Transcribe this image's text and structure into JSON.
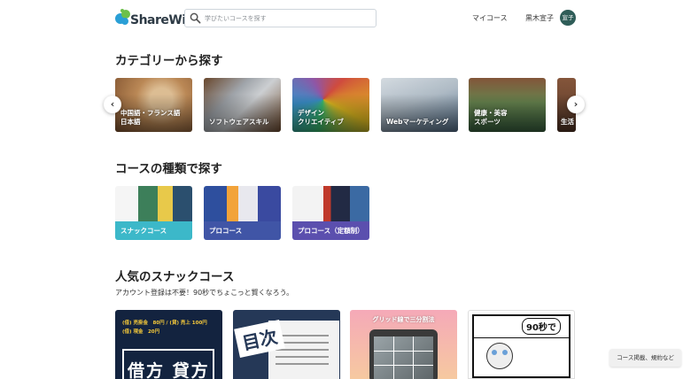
{
  "header": {
    "logo_text": "ShareWis",
    "search_placeholder": "学びたいコースを探す",
    "nav_my_courses": "マイコース",
    "nav_user_name": "黒木宣子",
    "avatar_text": "宣子"
  },
  "categories": {
    "title": "カテゴリーから探す",
    "items": [
      {
        "label": "中国語・フランス語\n日本語"
      },
      {
        "label": "ソフトウェアスキル"
      },
      {
        "label": "デザイン\nクリエイティブ"
      },
      {
        "label": "Webマーケティング"
      },
      {
        "label": "健康・美容\nスポーツ"
      },
      {
        "label": "生活"
      }
    ]
  },
  "course_types": {
    "title": "コースの種類で探す",
    "items": [
      {
        "label": "スナックコース",
        "color": "#3cb8c9"
      },
      {
        "label": "プロコース",
        "color": "#4055a6"
      },
      {
        "label": "プロコース（定額制）",
        "color": "#5b4fae"
      }
    ]
  },
  "snack": {
    "title": "人気のスナックコース",
    "subtitle": "アカウント登録は不要！90秒でちょこっと賢くなろう。",
    "cards": [
      {
        "lines": [
          "(借) 売掛金　80円 / (貸) 売上 100円",
          "(借) 現金　20円"
        ],
        "big": "借方 貸方"
      },
      {
        "big": "目次"
      },
      {
        "banner": "グリッド線で三分割法"
      },
      {
        "badge": "90秒で"
      }
    ]
  },
  "toast": "コース掲載、規約など",
  "colors": {
    "accent": "#2f5d58",
    "logo_blue": "#2a9fd6",
    "logo_green": "#6cc04a"
  }
}
